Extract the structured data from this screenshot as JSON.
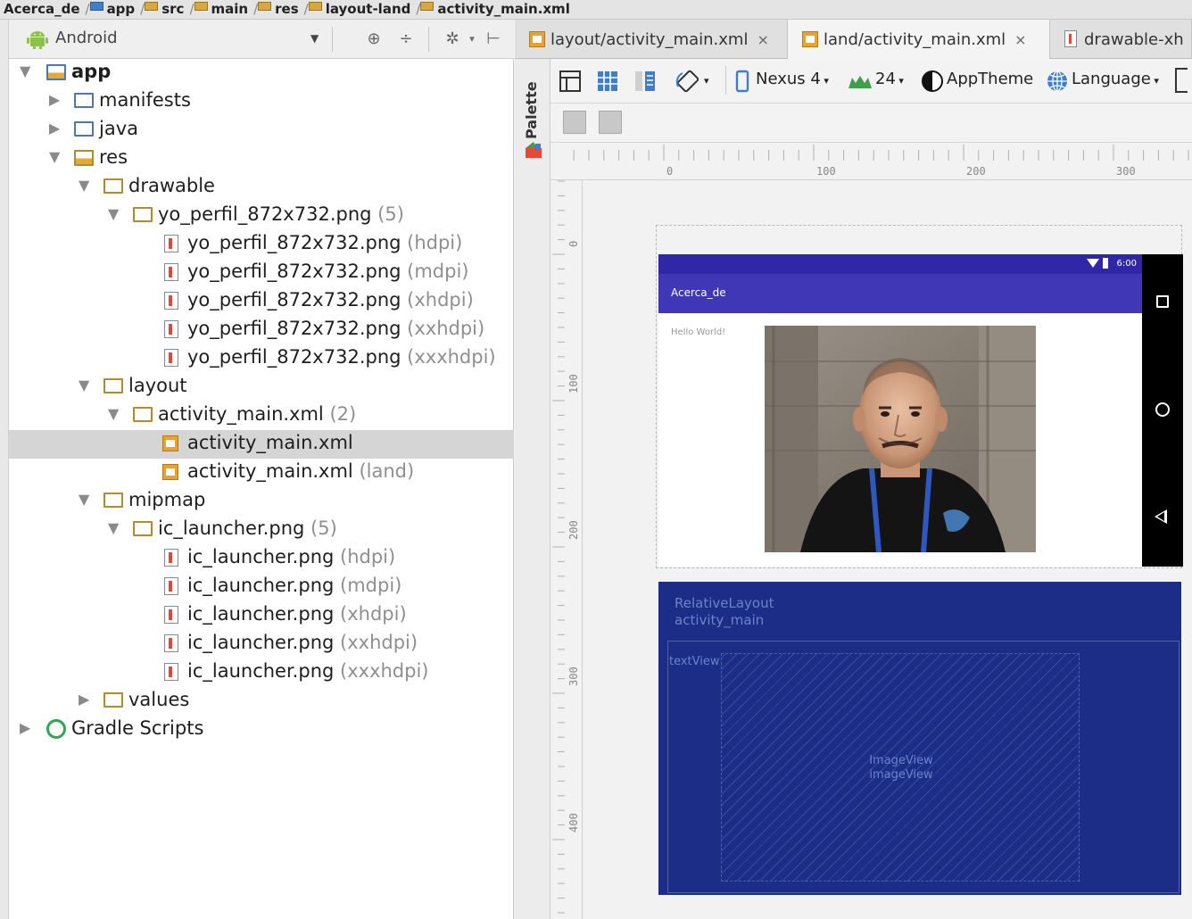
{
  "breadcrumb": [
    "Acerca_de",
    "app",
    "src",
    "main",
    "res",
    "layout-land",
    "activity_main.xml"
  ],
  "project_panel": {
    "view_label": "Android"
  },
  "tree": [
    {
      "label": "app",
      "suffix": "",
      "indent": 0,
      "arrow": "▼",
      "icon": "module",
      "bold": true
    },
    {
      "label": "manifests",
      "suffix": "",
      "indent": 1,
      "arrow": "▶",
      "icon": "folder"
    },
    {
      "label": "java",
      "suffix": "",
      "indent": 1,
      "arrow": "▶",
      "icon": "folder"
    },
    {
      "label": "res",
      "suffix": "",
      "indent": 1,
      "arrow": "▼",
      "icon": "res-folder"
    },
    {
      "label": "drawable",
      "suffix": "",
      "indent": 2,
      "arrow": "▼",
      "icon": "folder-gold"
    },
    {
      "label": "yo_perfil_872x732.png",
      "suffix": " (5)",
      "indent": 3,
      "arrow": "▼",
      "icon": "folder-gold"
    },
    {
      "label": "yo_perfil_872x732.png",
      "suffix": " (hdpi)",
      "indent": 4,
      "arrow": "",
      "icon": "image-file"
    },
    {
      "label": "yo_perfil_872x732.png",
      "suffix": " (mdpi)",
      "indent": 4,
      "arrow": "",
      "icon": "image-file"
    },
    {
      "label": "yo_perfil_872x732.png",
      "suffix": " (xhdpi)",
      "indent": 4,
      "arrow": "",
      "icon": "image-file"
    },
    {
      "label": "yo_perfil_872x732.png",
      "suffix": " (xxhdpi)",
      "indent": 4,
      "arrow": "",
      "icon": "image-file"
    },
    {
      "label": "yo_perfil_872x732.png",
      "suffix": " (xxxhdpi)",
      "indent": 4,
      "arrow": "",
      "icon": "image-file"
    },
    {
      "label": "layout",
      "suffix": "",
      "indent": 2,
      "arrow": "▼",
      "icon": "folder-gold"
    },
    {
      "label": "activity_main.xml",
      "suffix": " (2)",
      "indent": 3,
      "arrow": "▼",
      "icon": "folder-gold"
    },
    {
      "label": "activity_main.xml",
      "suffix": "",
      "indent": 4,
      "arrow": "",
      "icon": "xml-file",
      "selected": true
    },
    {
      "label": "activity_main.xml",
      "suffix": " (land)",
      "indent": 4,
      "arrow": "",
      "icon": "xml-file"
    },
    {
      "label": "mipmap",
      "suffix": "",
      "indent": 2,
      "arrow": "▼",
      "icon": "folder-gold"
    },
    {
      "label": "ic_launcher.png",
      "suffix": " (5)",
      "indent": 3,
      "arrow": "▼",
      "icon": "folder-gold"
    },
    {
      "label": "ic_launcher.png",
      "suffix": " (hdpi)",
      "indent": 4,
      "arrow": "",
      "icon": "image-file"
    },
    {
      "label": "ic_launcher.png",
      "suffix": " (mdpi)",
      "indent": 4,
      "arrow": "",
      "icon": "image-file"
    },
    {
      "label": "ic_launcher.png",
      "suffix": " (xhdpi)",
      "indent": 4,
      "arrow": "",
      "icon": "image-file"
    },
    {
      "label": "ic_launcher.png",
      "suffix": " (xxhdpi)",
      "indent": 4,
      "arrow": "",
      "icon": "image-file"
    },
    {
      "label": "ic_launcher.png",
      "suffix": " (xxxhdpi)",
      "indent": 4,
      "arrow": "",
      "icon": "image-file"
    },
    {
      "label": "values",
      "suffix": "",
      "indent": 2,
      "arrow": "▶",
      "icon": "folder-gold"
    },
    {
      "label": "Gradle Scripts",
      "suffix": "",
      "indent": 0,
      "arrow": "▶",
      "icon": "gradle"
    }
  ],
  "editor_tabs": [
    {
      "label": "layout/activity_main.xml",
      "close": "×",
      "icon": "xml-file"
    },
    {
      "label": "land/activity_main.xml",
      "close": "×",
      "icon": "xml-file",
      "active": true
    },
    {
      "label": "drawable-xh",
      "close": "",
      "icon": "image-file"
    }
  ],
  "palette_label": "Palette",
  "design_toolbar": {
    "device": "Nexus 4",
    "api": "24",
    "theme": "AppTheme",
    "language": "Language"
  },
  "ruler_top": [
    "0",
    "100",
    "200",
    "300"
  ],
  "ruler_left": [
    "0",
    "100",
    "200",
    "300",
    "400"
  ],
  "preview": {
    "status_time": "6:00",
    "app_title": "Acerca_de",
    "hello_text": "Hello World!"
  },
  "blueprint": {
    "layout_type": "RelativeLayout",
    "layout_id": "activity_main",
    "textview_label": "textView",
    "imageview_type": "ImageView",
    "imageview_id": "imageView"
  },
  "colors": {
    "app_bar": "#3f37b6",
    "status_bar": "#3027a8",
    "blueprint": "#1b2d86"
  }
}
